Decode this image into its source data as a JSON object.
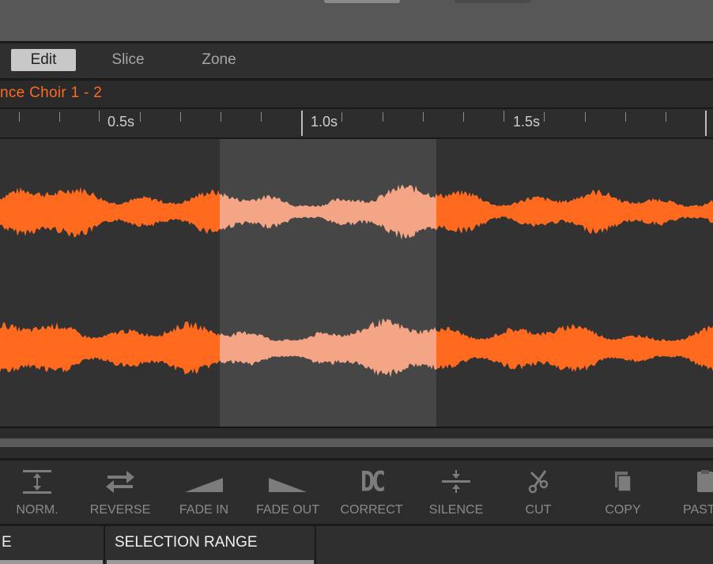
{
  "tabs": [
    {
      "label": "Edit",
      "active": true
    },
    {
      "label": "Slice",
      "active": false
    },
    {
      "label": "Zone",
      "active": false
    }
  ],
  "sample_title": "nce Choir 1 - 2",
  "ruler": {
    "labels": [
      "0.5s",
      "1.0s",
      "1.5s"
    ]
  },
  "waveform": {
    "color": "#ff6a1f",
    "selected_color": "#f4a585",
    "selection_bg": "#464646"
  },
  "tools": [
    {
      "label": "NORM.",
      "icon": "normalize-icon"
    },
    {
      "label": "REVERSE",
      "icon": "reverse-icon"
    },
    {
      "label": "FADE IN",
      "icon": "fade-in-icon"
    },
    {
      "label": "FADE OUT",
      "icon": "fade-out-icon"
    },
    {
      "label": "CORRECT",
      "icon": "dc-correct-icon",
      "glyph": "DC"
    },
    {
      "label": "SILENCE",
      "icon": "silence-icon"
    },
    {
      "label": "CUT",
      "icon": "scissors-icon"
    },
    {
      "label": "COPY",
      "icon": "copy-icon"
    },
    {
      "label": "PAST",
      "icon": "paste-icon"
    }
  ],
  "bottom_tabs": [
    {
      "label": "E"
    },
    {
      "label": "SELECTION RANGE"
    }
  ]
}
